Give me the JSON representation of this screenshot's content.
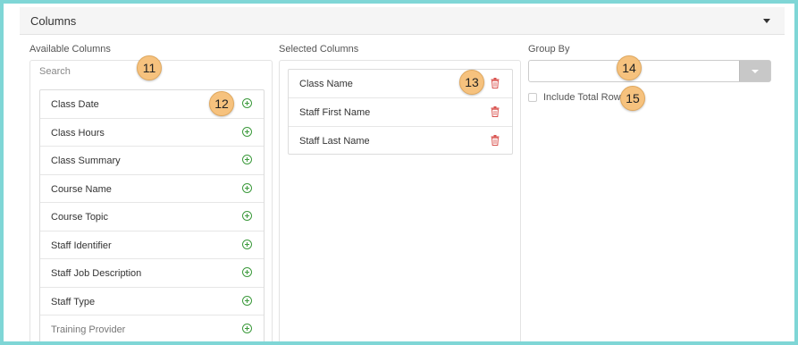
{
  "panel": {
    "title": "Columns"
  },
  "available": {
    "label": "Available Columns",
    "search_placeholder": "Search",
    "items": [
      "Class Date",
      "Class Hours",
      "Class Summary",
      "Course Name",
      "Course Topic",
      "Staff Identifier",
      "Staff Job Description",
      "Staff Type",
      "Training Provider"
    ]
  },
  "selected": {
    "label": "Selected Columns",
    "items": [
      "Class Name",
      "Staff First Name",
      "Staff Last Name"
    ]
  },
  "group_by": {
    "label": "Group By",
    "value": "",
    "include_total_row_label": "Include Total Row",
    "include_total_row_checked": false
  },
  "callouts": [
    "11",
    "12",
    "13",
    "14",
    "15"
  ],
  "icons": {
    "add": "plus-circle-icon",
    "remove": "trash-icon",
    "collapse": "caret-down-icon"
  },
  "colors": {
    "add_icon": "#3c9a3c",
    "remove_icon": "#d9534f",
    "callout": "#f6c27e",
    "frame": "#7fd6d6"
  }
}
